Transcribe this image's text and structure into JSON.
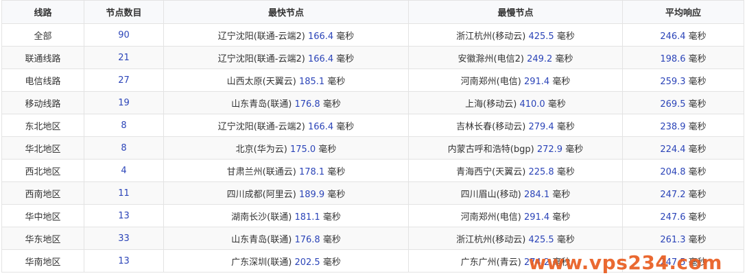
{
  "headers": [
    "线路",
    "节点数目",
    "最快节点",
    "最慢节点",
    "平均响应"
  ],
  "unit": "毫秒",
  "rows": [
    {
      "route": "全部",
      "count": "90",
      "fast_node": "辽宁沈阳(联通-云端2)",
      "fast_ms": "166.4",
      "slow_node": "浙江杭州(移动云)",
      "slow_ms": "425.5",
      "avg_ms": "246.4"
    },
    {
      "route": "联通线路",
      "count": "21",
      "fast_node": "辽宁沈阳(联通-云端2)",
      "fast_ms": "166.4",
      "slow_node": "安徽滁州(电信2)",
      "slow_ms": "249.2",
      "avg_ms": "198.6"
    },
    {
      "route": "电信线路",
      "count": "27",
      "fast_node": "山西太原(天翼云)",
      "fast_ms": "185.1",
      "slow_node": "河南郑州(电信)",
      "slow_ms": "291.4",
      "avg_ms": "259.3"
    },
    {
      "route": "移动线路",
      "count": "19",
      "fast_node": "山东青岛(联通)",
      "fast_ms": "176.8",
      "slow_node": "上海(移动云)",
      "slow_ms": "410.0",
      "avg_ms": "269.5"
    },
    {
      "route": "东北地区",
      "count": "8",
      "fast_node": "辽宁沈阳(联通-云端2)",
      "fast_ms": "166.4",
      "slow_node": "吉林长春(移动云)",
      "slow_ms": "279.4",
      "avg_ms": "238.9"
    },
    {
      "route": "华北地区",
      "count": "8",
      "fast_node": "北京(华为云)",
      "fast_ms": "175.0",
      "slow_node": "内蒙古呼和浩特(bgp)",
      "slow_ms": "272.9",
      "avg_ms": "224.4"
    },
    {
      "route": "西北地区",
      "count": "4",
      "fast_node": "甘肃兰州(联通云)",
      "fast_ms": "178.1",
      "slow_node": "青海西宁(天翼云)",
      "slow_ms": "225.8",
      "avg_ms": "204.8"
    },
    {
      "route": "西南地区",
      "count": "11",
      "fast_node": "四川成都(阿里云)",
      "fast_ms": "189.9",
      "slow_node": "四川眉山(移动)",
      "slow_ms": "284.1",
      "avg_ms": "247.2"
    },
    {
      "route": "华中地区",
      "count": "13",
      "fast_node": "湖南长沙(联通)",
      "fast_ms": "181.1",
      "slow_node": "河南郑州(电信)",
      "slow_ms": "291.4",
      "avg_ms": "247.6"
    },
    {
      "route": "华东地区",
      "count": "33",
      "fast_node": "山东青岛(联通)",
      "fast_ms": "176.8",
      "slow_node": "浙江杭州(移动云)",
      "slow_ms": "425.5",
      "avg_ms": "261.3"
    },
    {
      "route": "华南地区",
      "count": "13",
      "fast_node": "广东深圳(联通)",
      "fast_ms": "202.5",
      "slow_node": "广东广州(青云)",
      "slow_ms": "274.2",
      "avg_ms": "247.5"
    }
  ],
  "watermark": "www.vps234.com",
  "colors": {
    "value_blue": "#2b44b8",
    "border": "#e3e3e3",
    "header_bg": "#f8f9fb",
    "stripe_bg": "#f9f9f9",
    "watermark_orange": "#e85c20"
  }
}
